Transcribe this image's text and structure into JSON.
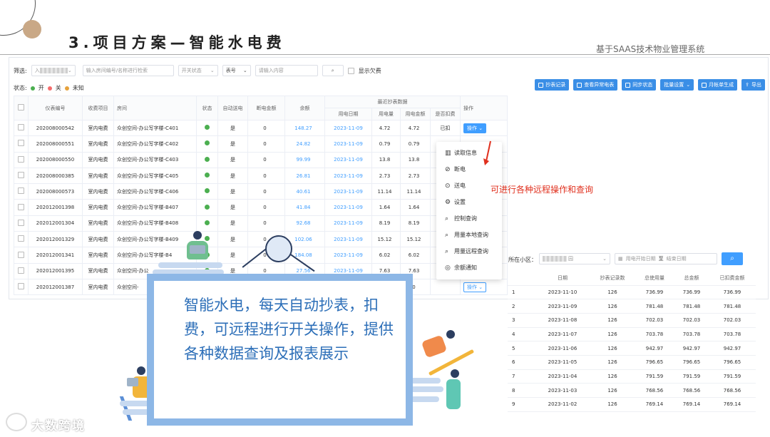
{
  "slide": {
    "title": "3.项目方案—智能水电费",
    "subtitle": "基于SAAS技术物业管理系统"
  },
  "filter": {
    "label": "筛选:",
    "project_prefix": "入",
    "search_placeholder": "输入房间编号/名称进行检索",
    "switch_status": "开关状态",
    "meter_no": "表号",
    "input_placeholder": "请输入内容",
    "show_arrears": "显示欠费"
  },
  "status": {
    "label": "状态:",
    "on": "开",
    "off": "关",
    "unknown": "未知"
  },
  "colors": {
    "accent": "#409eff",
    "on": "#4caf50",
    "off": "#f56c6c",
    "unknown": "#e6a23c",
    "callout": "#2d6fb8"
  },
  "toolbar": [
    "抄表记录",
    "查看异常电表",
    "同步状态",
    "批量设置",
    "月帐单生成",
    "导出"
  ],
  "table": {
    "headers": [
      "仪表编号",
      "收费项目",
      "房间",
      "状态",
      "自动送电",
      "断电金额",
      "余额",
      "操作"
    ],
    "group_header": "最近抄表数据",
    "sub_headers": [
      "用电日期",
      "用电量",
      "用电金额",
      "是否扣费"
    ],
    "rows": [
      {
        "id": "202008000542",
        "item": "室内电费",
        "room": "众创空间-办公写字楼-C401",
        "auto": "是",
        "cut": "0",
        "bal": "148.27",
        "date": "2023-11-09",
        "qty": "4.72",
        "amt": "4.72",
        "ded": "已扣",
        "op": "操作"
      },
      {
        "id": "202008000551",
        "item": "室内电费",
        "room": "众创空间-办公写字楼-C402",
        "auto": "是",
        "cut": "0",
        "bal": "24.82",
        "date": "2023-11-09",
        "qty": "0.79",
        "amt": "0.79",
        "ded": "",
        "op": ""
      },
      {
        "id": "202008000550",
        "item": "室内电费",
        "room": "众创空间-办公写字楼-C403",
        "auto": "是",
        "cut": "0",
        "bal": "99.99",
        "date": "2023-11-09",
        "qty": "13.8",
        "amt": "13.8",
        "ded": "",
        "op": ""
      },
      {
        "id": "202008000385",
        "item": "室内电费",
        "room": "众创空间-办公写字楼-C405",
        "auto": "是",
        "cut": "0",
        "bal": "26.81",
        "date": "2023-11-09",
        "qty": "2.73",
        "amt": "2.73",
        "ded": "",
        "op": ""
      },
      {
        "id": "202008000573",
        "item": "室内电费",
        "room": "众创空间-办公写字楼-C406",
        "auto": "是",
        "cut": "0",
        "bal": "40.61",
        "date": "2023-11-09",
        "qty": "11.14",
        "amt": "11.14",
        "ded": "",
        "op": ""
      },
      {
        "id": "202012001398",
        "item": "室内电费",
        "room": "众创空间-办公写字楼-B407",
        "auto": "是",
        "cut": "0",
        "bal": "41.84",
        "date": "2023-11-09",
        "qty": "1.64",
        "amt": "1.64",
        "ded": "",
        "op": ""
      },
      {
        "id": "202012001304",
        "item": "室内电费",
        "room": "众创空间-办公写字楼-B408",
        "auto": "是",
        "cut": "0",
        "bal": "92.68",
        "date": "2023-11-09",
        "qty": "8.19",
        "amt": "8.19",
        "ded": "",
        "op": ""
      },
      {
        "id": "202012001329",
        "item": "室内电费",
        "room": "众创空间-办公写字楼-B409",
        "auto": "是",
        "cut": "0",
        "bal": "102.06",
        "date": "2023-11-09",
        "qty": "15.12",
        "amt": "15.12",
        "ded": "",
        "op": ""
      },
      {
        "id": "202012001341",
        "item": "室内电费",
        "room": "众创空间-办公写字楼-B4",
        "auto": "是",
        "cut": "0",
        "bal": "184.08",
        "date": "2023-11-09",
        "qty": "6.02",
        "amt": "6.02",
        "ded": "",
        "op": ""
      },
      {
        "id": "202012001395",
        "item": "室内电费",
        "room": "众创空间-办公",
        "auto": "是",
        "cut": "0",
        "bal": "27.56",
        "date": "2023-11-09",
        "qty": "7.63",
        "amt": "7.63",
        "ded": "",
        "op": ""
      },
      {
        "id": "202012001387",
        "item": "室内电费",
        "room": "众创空间-",
        "auto": "",
        "cut": "",
        "bal": "",
        "date": "",
        "qty": "",
        "amt": "0",
        "ded": "",
        "op": "操作"
      }
    ]
  },
  "menu": [
    "读取信息",
    "断电",
    "送电",
    "设置",
    "控制查询",
    "用量本地查询",
    "用量远程查询",
    "余额通知"
  ],
  "menu_icons": [
    "book-icon",
    "power-off-icon",
    "power-on-icon",
    "gear-icon",
    "search-icon",
    "search-icon",
    "search-icon",
    "bell-icon"
  ],
  "annotation": "可进行各种远程操作和查询",
  "right_panel": {
    "label": "所在小区：",
    "select_value": "园",
    "start_placeholder": "用电开始日期",
    "to": "至",
    "end_placeholder": "结束日期",
    "headers": [
      "",
      "日期",
      "抄表记录数",
      "总使用量",
      "总金额",
      "已扣费金额"
    ],
    "rows": [
      [
        "1",
        "2023-11-10",
        "126",
        "736.99",
        "736.99",
        "736.99"
      ],
      [
        "2",
        "2023-11-09",
        "126",
        "781.48",
        "781.48",
        "781.48"
      ],
      [
        "3",
        "2023-11-08",
        "126",
        "702.03",
        "702.03",
        "702.03"
      ],
      [
        "4",
        "2023-11-07",
        "126",
        "703.78",
        "703.78",
        "703.78"
      ],
      [
        "5",
        "2023-11-06",
        "126",
        "942.97",
        "942.97",
        "942.97"
      ],
      [
        "6",
        "2023-11-05",
        "126",
        "796.65",
        "796.65",
        "796.65"
      ],
      [
        "7",
        "2023-11-04",
        "126",
        "791.59",
        "791.59",
        "791.59"
      ],
      [
        "8",
        "2023-11-03",
        "126",
        "768.56",
        "768.56",
        "768.56"
      ],
      [
        "9",
        "2023-11-02",
        "126",
        "769.14",
        "769.14",
        "769.14"
      ]
    ]
  },
  "callout": "智能水电，每天自动抄表，扣费，可远程进行开关操作，提供各种数据查询及报表展示",
  "logo": "大数跨境"
}
